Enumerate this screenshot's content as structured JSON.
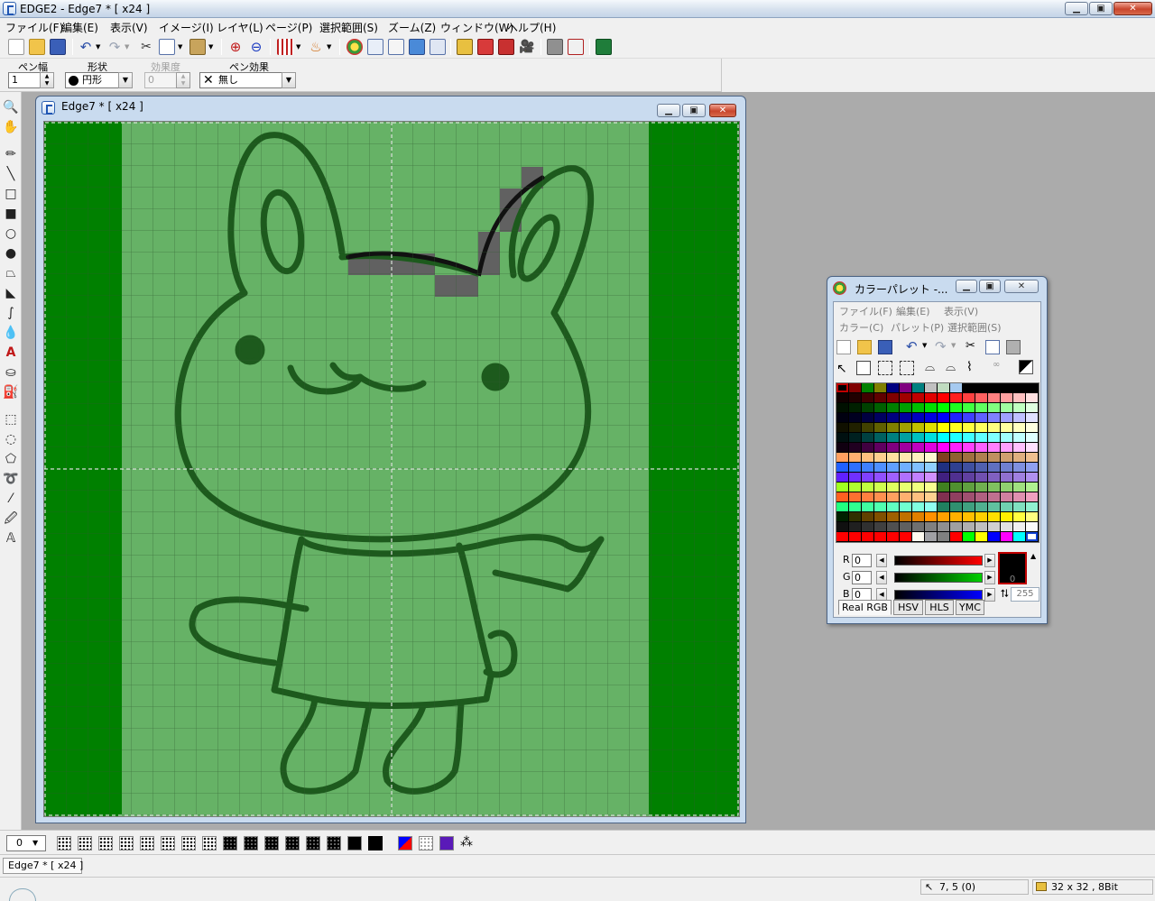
{
  "app": {
    "title": "EDGE2 - Edge7 * [ x24 ]",
    "window_buttons": [
      "minimize",
      "maximize",
      "close"
    ]
  },
  "menu": [
    "ファイル(F)",
    "編集(E)",
    "表示(V)",
    "イメージ(I)",
    "レイヤ(L)",
    "ページ(P)",
    "選択範囲(S)",
    "ズーム(Z)",
    "ウィンドウ(W)",
    "ヘルプ(H)"
  ],
  "options": {
    "pen_width_label": "ペン幅",
    "pen_width_value": "1",
    "shape_label": "形状",
    "shape_value": "円形",
    "effect_strength_label": "効果度",
    "effect_strength_value": "0",
    "pen_effect_label": "ペン効果",
    "pen_effect_value": "無し"
  },
  "document": {
    "title": "Edge7 * [ x24 ]",
    "grid": "32 x 32",
    "colors": {
      "dark_green": "#008000",
      "light_green": "#66b266",
      "line": "#1d5a1d",
      "gray_pixels": "#616161",
      "black_line": "#111111"
    }
  },
  "palette": {
    "title": "カラーパレット -...",
    "menu_row1": [
      "ファイル(F)",
      "編集(E)",
      "表示(V)"
    ],
    "menu_row2": [
      "カラー(C)",
      "パレット(P)",
      "選択範囲(S)"
    ],
    "channels": [
      {
        "label": "R",
        "value": "0",
        "color": "#ff0000"
      },
      {
        "label": "G",
        "value": "0",
        "color": "#00c000"
      },
      {
        "label": "B",
        "value": "0",
        "color": "#0000ff"
      }
    ],
    "current_color_index": "0",
    "alpha_value": "255",
    "tabs": [
      "Real RGB",
      "HSV",
      "HLS",
      "YMC"
    ],
    "active_tab": "Real RGB"
  },
  "bottom": {
    "dither_value": "0",
    "task_tab": "Edge7 * [ x24 ]"
  },
  "status": {
    "cursor_position": "7, 5 (0)",
    "image_info": "32 x 32 , 8Bit"
  }
}
